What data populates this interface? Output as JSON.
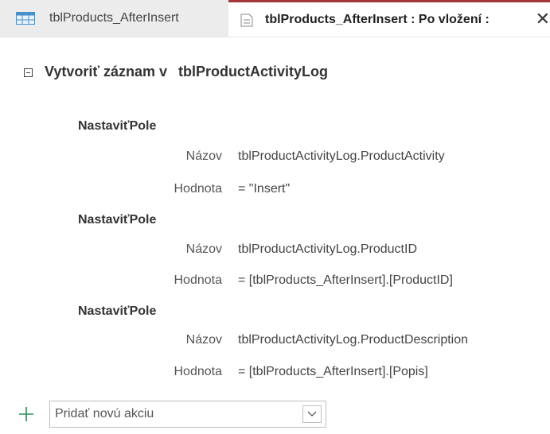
{
  "tabs": [
    {
      "label": "tblProducts_AfterInsert",
      "active": false
    },
    {
      "label": "tblProducts_AfterInsert : Po vložení :",
      "active": true
    }
  ],
  "close_glyph": "✕",
  "macro": {
    "create_record_label": "Vytvoriť záznam v",
    "create_record_table": "tblProductActivityLog",
    "setfield_title": "NastaviťPole",
    "name_label": "Názov",
    "value_label": "Hodnota",
    "setfields": [
      {
        "name": "tblProductActivityLog.ProductActivity",
        "value": "= \"Insert\""
      },
      {
        "name": "tblProductActivityLog.ProductID",
        "value": "= [tblProducts_AfterInsert].[ProductID]"
      },
      {
        "name": "tblProductActivityLog.ProductDescription",
        "value": "= [tblProducts_AfterInsert].[Popis]"
      }
    ]
  },
  "add_action": {
    "placeholder": "Pridať novú akciu"
  },
  "colors": {
    "active_tab_accent": "#a4373a",
    "plus_icon": "#2e8b57",
    "table_icon": "#4a90c8"
  }
}
